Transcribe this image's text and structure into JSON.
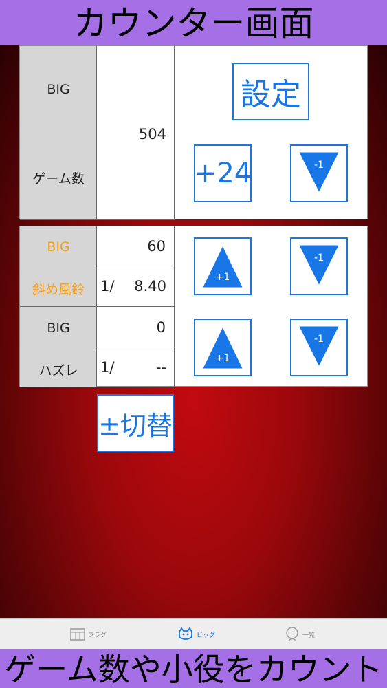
{
  "banners": {
    "top": "カウンター画面",
    "bottom": "ゲーム数や小役をカウント"
  },
  "game_panel": {
    "label_big": "BIG",
    "label_games": "ゲーム数",
    "value": "504",
    "settings_label": "設定",
    "plus24_label": "+24",
    "minus_label": "-1"
  },
  "counter1": {
    "label_big": "BIG",
    "label_role": "斜め風鈴",
    "count": "60",
    "prefix": "1/",
    "ratio": "8.40",
    "plus_label": "+1",
    "minus_label": "-1"
  },
  "counter2": {
    "label_big": "BIG",
    "label_role": "ハズレ",
    "count": "0",
    "prefix": "1/",
    "ratio": "--",
    "plus_label": "+1",
    "minus_label": "-1"
  },
  "toggle_label": "±切替",
  "tabs": [
    {
      "label": "フラグ",
      "icon": "flag-table-icon",
      "active": false
    },
    {
      "label": "ビッグ",
      "icon": "big-cat-icon",
      "active": true
    },
    {
      "label": "一覧",
      "icon": "list-person-icon",
      "active": false
    }
  ],
  "colors": {
    "accent": "#1976e6",
    "banner": "#a56fe6",
    "label_orange": "#f0a020"
  }
}
